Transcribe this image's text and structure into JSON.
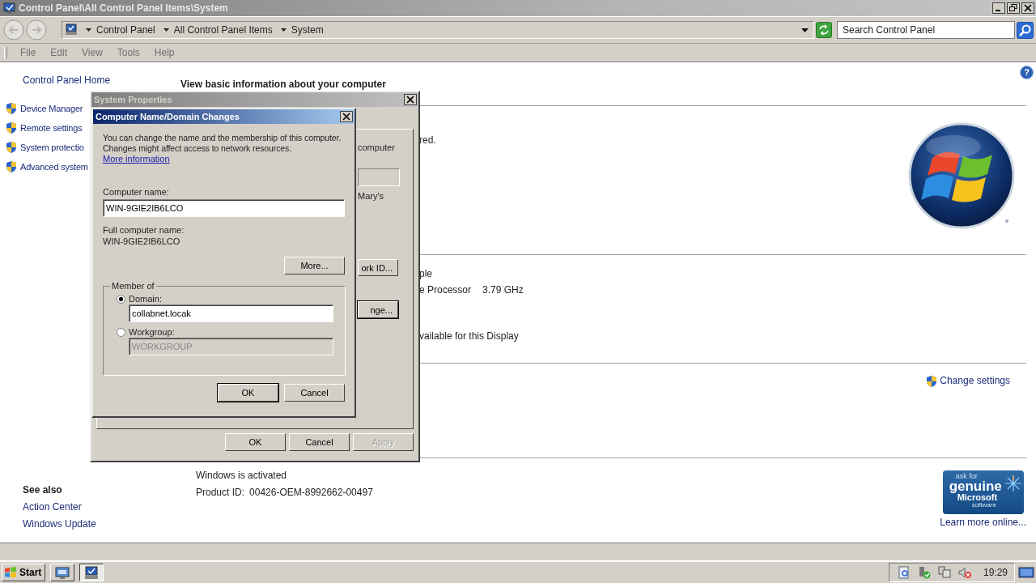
{
  "window": {
    "title": "Control Panel\\All Control Panel Items\\System"
  },
  "address_bar": {
    "crumbs": [
      "Control Panel",
      "All Control Panel Items",
      "System"
    ]
  },
  "search": {
    "placeholder": "Search Control Panel"
  },
  "menu": [
    "File",
    "Edit",
    "View",
    "Tools",
    "Help"
  ],
  "help": "?",
  "sidebar": {
    "home": "Control Panel Home",
    "tasks": [
      "Device Manager",
      "Remote settings",
      "System protectio",
      "Advanced system"
    ],
    "see_also": {
      "title": "See also",
      "links": [
        "Action Center",
        "Windows Update"
      ]
    }
  },
  "main": {
    "heading": "View basic information about your computer",
    "section_1": {
      "text": "red."
    },
    "section_2": {
      "rows": [
        {
          "label": "ple"
        },
        {
          "label": "e Processor",
          "value": "3.79 GHz"
        }
      ],
      "footer": "vailable for this Display"
    },
    "section_3": {
      "link": "Change settings"
    },
    "activation": {
      "status": "Windows is activated",
      "product_id_label": "Product ID:",
      "product_id": "00426-OEM-8992662-00497"
    },
    "genuine": {
      "lines": [
        "ask for",
        "genuine",
        "Microsoft",
        "software"
      ],
      "link": "Learn more online..."
    }
  },
  "system_properties": {
    "title": "System Properties",
    "pane": {
      "text_1": "computer",
      "text_2": "Mary's",
      "button_1": "ork ID...",
      "button_2": "nge..."
    },
    "buttons": [
      {
        "label": "OK",
        "disabled": false
      },
      {
        "label": "Cancel",
        "disabled": false
      },
      {
        "label": "Apply",
        "disabled": true
      }
    ]
  },
  "name_dialog": {
    "title": "Computer Name/Domain Changes",
    "description": "You can change the name and the membership of this computer. Changes might affect access to network resources.",
    "link": "More information",
    "computer_name_label": "Computer name:",
    "computer_name": "WIN-9GIE2IB6LCO",
    "full_name_label": "Full computer name:",
    "full_name": "WIN-9GIE2IB6LCO",
    "more_button": "More...",
    "member_of": {
      "legend": "Member of",
      "options": [
        {
          "label": "Domain:",
          "selected": true,
          "value": "collabnet.locak"
        },
        {
          "label": "Workgroup:",
          "selected": false,
          "value": "WORKGROUP"
        }
      ]
    },
    "buttons": [
      {
        "label": "OK",
        "default": true
      },
      {
        "label": "Cancel",
        "default": false
      }
    ]
  },
  "taskbar": {
    "start": "Start",
    "tasks": [
      {
        "selected": false
      },
      {
        "selected": true
      }
    ],
    "clock": "19:29"
  }
}
